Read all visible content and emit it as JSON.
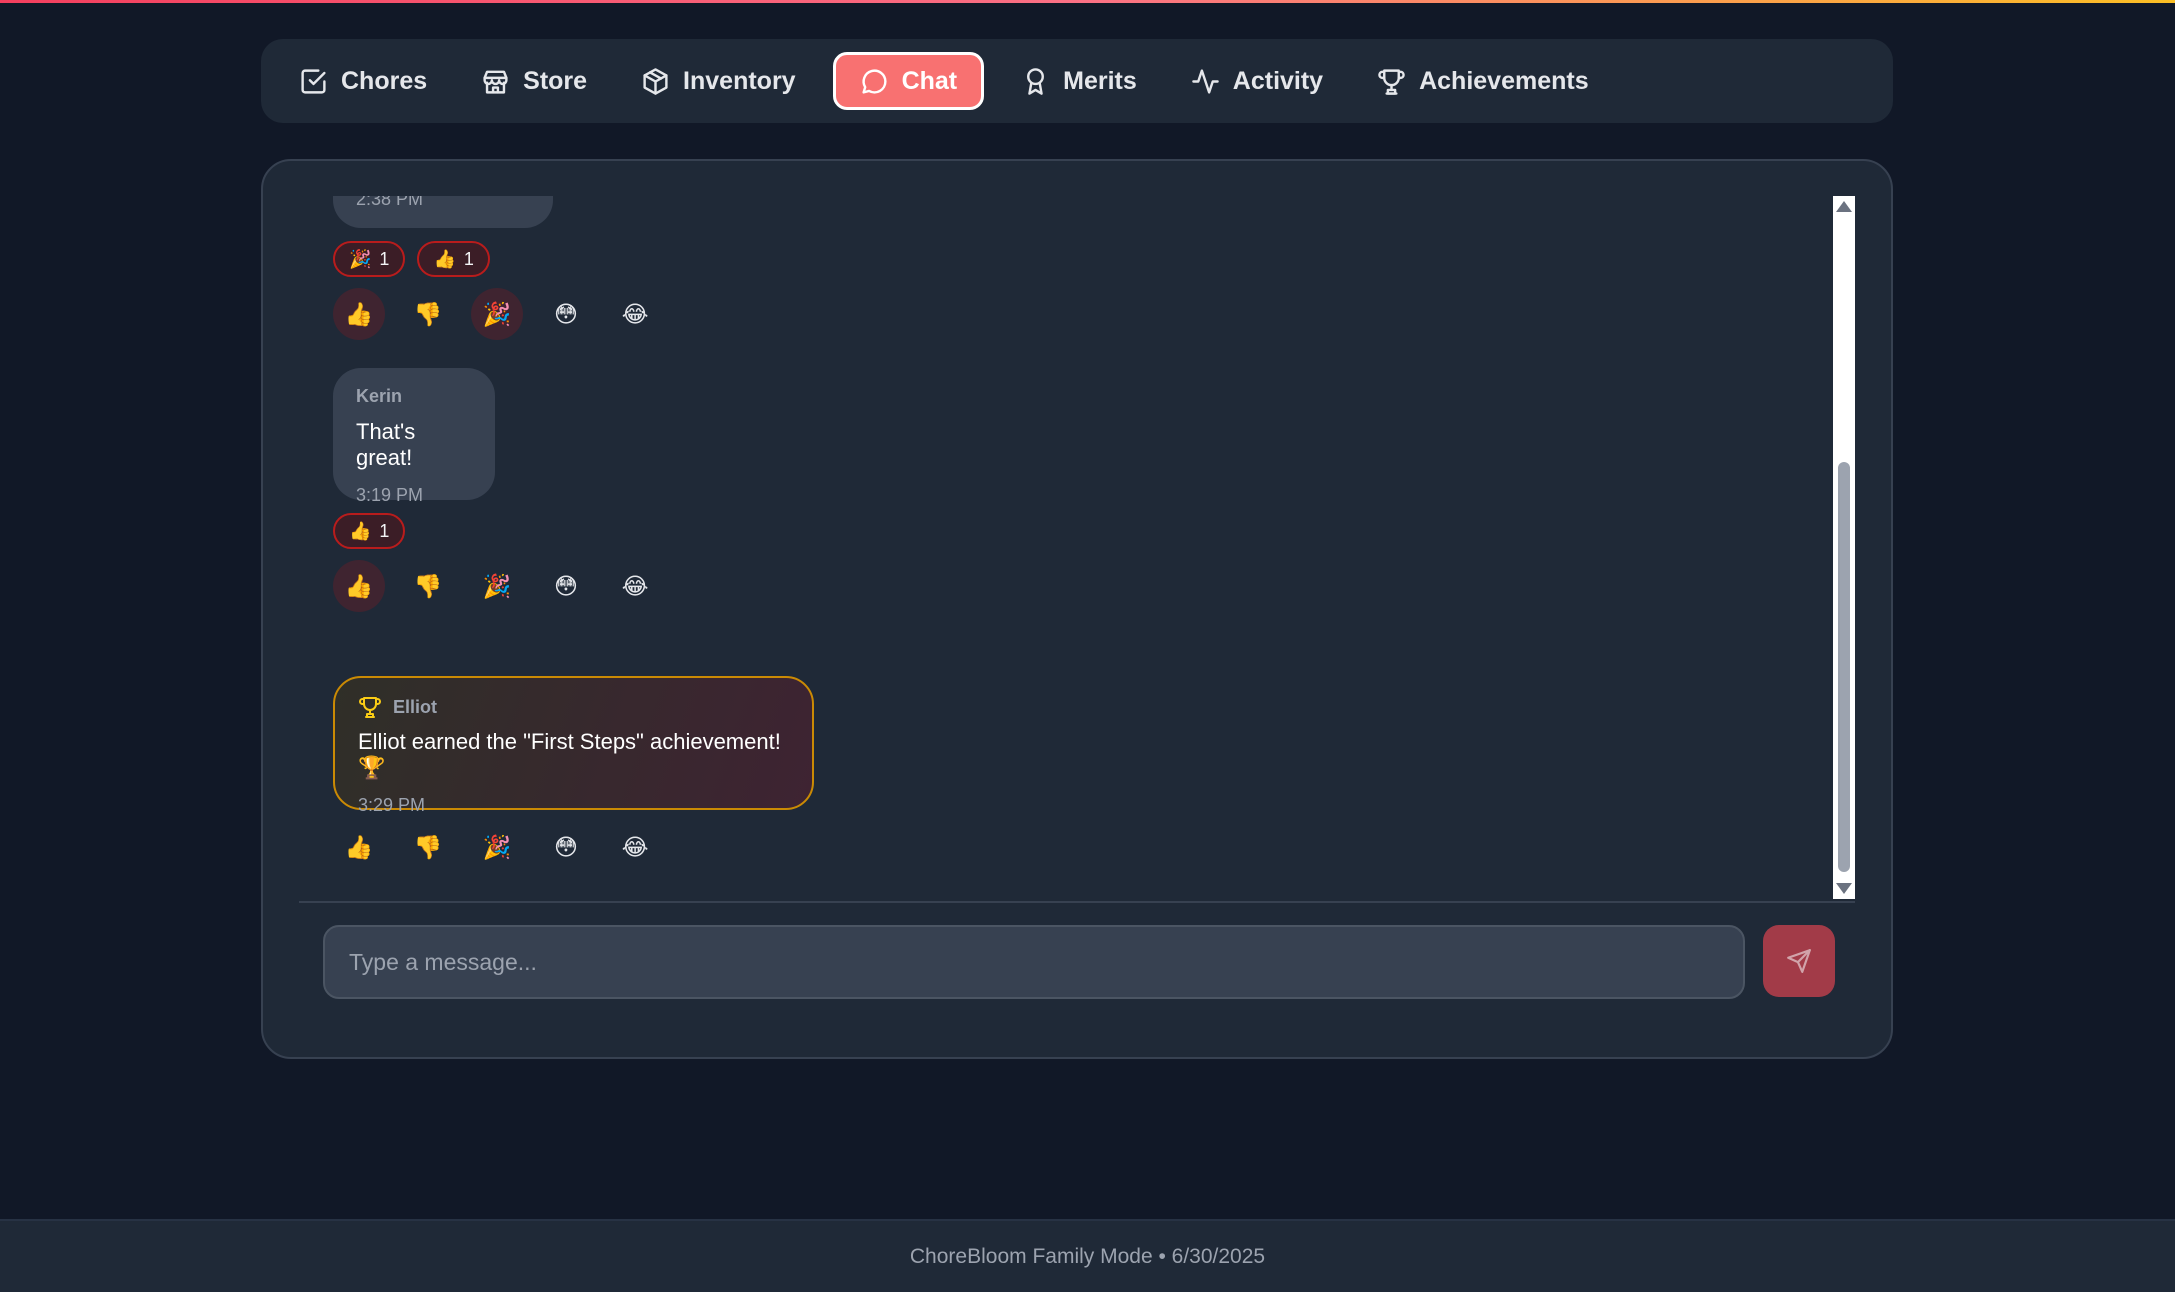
{
  "nav": {
    "tabs": [
      {
        "label": "Chores",
        "icon": "checkbox-icon"
      },
      {
        "label": "Store",
        "icon": "store-icon"
      },
      {
        "label": "Inventory",
        "icon": "package-icon"
      },
      {
        "label": "Chat",
        "icon": "chat-bubble-icon",
        "active": true
      },
      {
        "label": "Merits",
        "icon": "award-ribbon-icon"
      },
      {
        "label": "Activity",
        "icon": "activity-pulse-icon"
      },
      {
        "label": "Achievements",
        "icon": "trophy-icon"
      }
    ]
  },
  "chat": {
    "messages": [
      {
        "time": "2:38 PM",
        "reactions": [
          {
            "emoji": "🎉",
            "count": "1"
          },
          {
            "emoji": "👍",
            "count": "1"
          }
        ],
        "picker": [
          "👍",
          "👎",
          "🎉",
          "😳",
          "😂"
        ]
      },
      {
        "sender": "Kerin",
        "text": "That's great!",
        "time": "3:19 PM",
        "reactions": [
          {
            "emoji": "👍",
            "count": "1"
          }
        ],
        "picker": [
          "👍",
          "👎",
          "🎉",
          "😳",
          "😂"
        ]
      },
      {
        "sender": "Elliot",
        "text": "Elliot earned the \"First Steps\" achievement! 🏆",
        "time": "3:29 PM",
        "picker": [
          "👍",
          "👎",
          "🎉",
          "😳",
          "😂"
        ]
      }
    ],
    "input_placeholder": "Type a message..."
  },
  "footer": {
    "text": "ChoreBloom Family Mode • 6/30/2025"
  },
  "colors": {
    "accent": "#f87171",
    "background": "#111827",
    "panel": "#1f2937",
    "achievement_border": "#ca8a04"
  }
}
